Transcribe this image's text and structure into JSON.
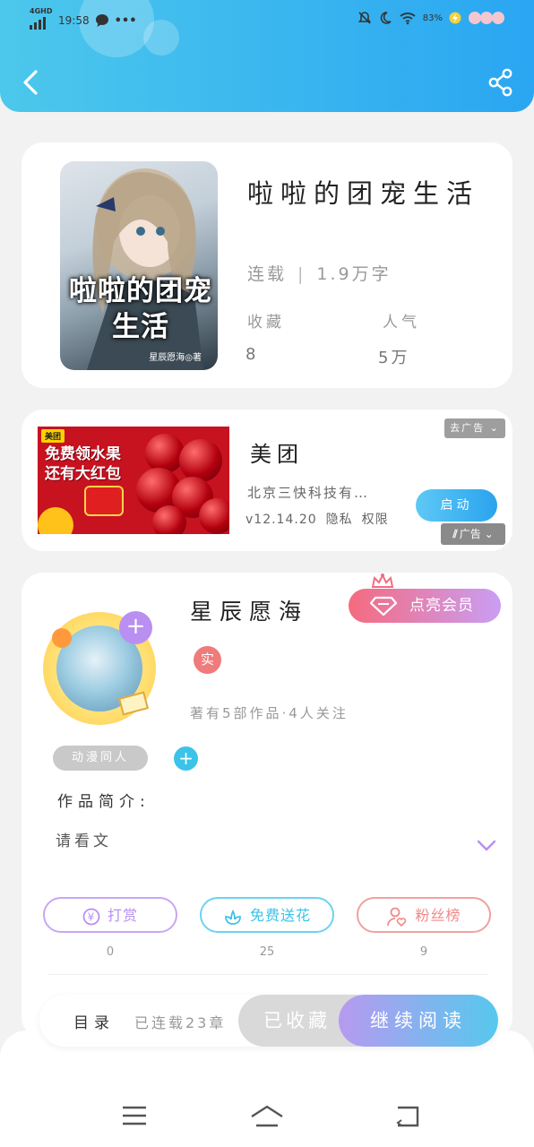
{
  "status_bar": {
    "network": "4GHD",
    "time": "19:58",
    "more": "•••",
    "battery": "83%"
  },
  "book": {
    "title": "啦啦的团宠生活",
    "status": "连载",
    "word_count": "1.9万字",
    "favorites_label": "收藏",
    "favorites_value": "8",
    "popularity_label": "人气",
    "popularity_value": "5万",
    "cover_title": "啦啦的团宠生活",
    "cover_author": "星辰愿海◎著"
  },
  "ad": {
    "image_brand": "美团",
    "image_headline_1": "免费领水果",
    "image_headline_2": "还有大红包",
    "name": "美团",
    "company": "北京三快科技有…",
    "version": "v12.14.20",
    "privacy": "隐私",
    "permissions": "权限",
    "close_label": "去广告",
    "start_label": "启动",
    "ad_label": "广告"
  },
  "author": {
    "name": "星辰愿海",
    "vip_label": "点亮会员",
    "real_badge": "实",
    "stats": "著有5部作品·4人关注",
    "tag": "动漫同人",
    "intro_label": "作品简介:",
    "intro_text": "请看文",
    "actions": [
      {
        "label": "打赏",
        "count": "0"
      },
      {
        "label": "免费送花",
        "count": "25"
      },
      {
        "label": "粉丝榜",
        "count": "9"
      }
    ]
  },
  "bottom_bar": {
    "toc_label": "目录",
    "chapter_status": "已连载23章",
    "collected_label": "已收藏",
    "read_label": "继续阅读"
  },
  "colors": {
    "header_gradient_start": "#4cc8ec",
    "header_gradient_end": "#2aa6f2",
    "reward_accent": "#b98ff2",
    "flower_accent": "#3bc3ea",
    "fans_accent": "#f08a8a"
  }
}
